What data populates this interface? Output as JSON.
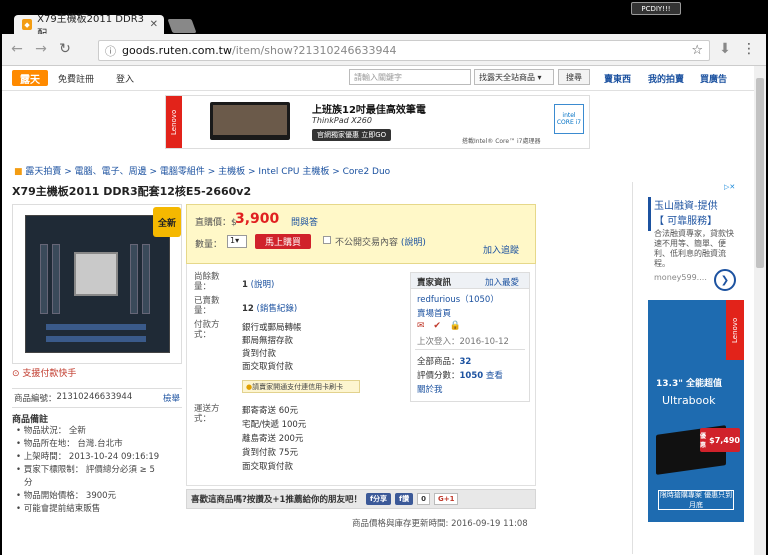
{
  "browser": {
    "tab_title": "X79主機板2011 DDR3配",
    "profile_label": "PCDIY!!!",
    "url_host": "goods.ruten.com.tw",
    "url_path": "/item/show?21310246633944"
  },
  "header": {
    "logo": "露天",
    "register": "免費註冊",
    "login": "登入",
    "search_placeholder": "請輸入關鍵字",
    "search_scope": "找露天全站商品",
    "search_button": "搜尋",
    "sell": "賣東西",
    "my_auction": "我的拍賣",
    "advertise": "買廣告"
  },
  "banner": {
    "headline": "上班族12吋最佳高效筆電",
    "model": "ThinkPad X260",
    "cta": "官網獨家優惠 立即GO",
    "badge_brand": "Lenovo",
    "intel_text": "搭載Intel® Core™ i7處理器",
    "intel_badge": "intel CORE i7"
  },
  "breadcrumb": "露天拍賣 > 電腦、電子、周邊 > 電腦零組件 > 主機板 > Intel CPU 主機板 > Core2 Duo",
  "product": {
    "title": "X79主機板2011 DDR3配套12核E5-2660v2",
    "new_badge": "全新",
    "fastpay": "支援付款快手",
    "id_label": "商品編號：",
    "id_value": "21310246633944",
    "report": "檢舉",
    "remarks_title": "商品備註",
    "remarks": [
      "物品狀況： 全新",
      "物品所在地： 台灣.台北市",
      "上架時間： 2013-10-24 09:16:19",
      "買家下標限制： 評價總分必須 ≥ 5",
      "分",
      "物品開始價格： 3900元",
      "可能會提前結束販售"
    ]
  },
  "buy": {
    "price_label": "直購價：$",
    "price": "3,900",
    "ask": "問與答",
    "qty_label": "數量：",
    "qty": "1",
    "buy_button": "馬上購買",
    "private_label": "不公開交易內容",
    "explain": "(說明)",
    "track": "加入追蹤"
  },
  "details": {
    "stock_label": "尚餘數量：",
    "stock_value": "1",
    "stock_link": "(說明)",
    "sold_label": "已賣數量：",
    "sold_value": "12",
    "sold_link": "(銷售紀錄)",
    "pay_label": "付款方式：",
    "pay": [
      "銀行或郵局轉帳",
      "郵局無摺存款",
      "貨到付款",
      "面交取貨付款"
    ],
    "pay_note": "請賣家開通支付連信用卡刷卡",
    "ship_label": "運送方式：",
    "ship": [
      "郵寄寄送 60元",
      "宅配/快遞 100元",
      "離島寄送 200元",
      "貨到付款 75元",
      "面交取貨付款"
    ]
  },
  "seller": {
    "heading": "賣家資訊",
    "add_fav": "加入最愛",
    "name": "redfurious（1050）",
    "store": "賣場首頁",
    "last_login": "上次登入：2016-10-12",
    "all_items_label": "全部商品：",
    "all_items": "32",
    "rating_label": "評價分數：",
    "rating": "1050",
    "view": "查看",
    "about": "關於我"
  },
  "share": {
    "text": "喜歡這商品嗎?按讚及+1推薦給你的朋友吧！",
    "fb_share": "分享",
    "fb_like": "讚",
    "like_count": "0",
    "gplus": "G+1"
  },
  "updated": "商品價格與庫存更新時間: 2016-09-19 11:08",
  "ad1": {
    "title": "玉山融資-提供",
    "subtitle": "【 可靠服務】",
    "body": "合法融資專家，貸款快速不用等、簡單、便利、低利息的融資流程。",
    "url": "money599...."
  },
  "ad2": {
    "brand": "Lenovo",
    "line1": "13.3\" 全能超值",
    "line2": "Ultrabook",
    "price": "$7,490",
    "price_prefix": "優惠",
    "cta": "限時搶購專案 優惠只到月底"
  }
}
